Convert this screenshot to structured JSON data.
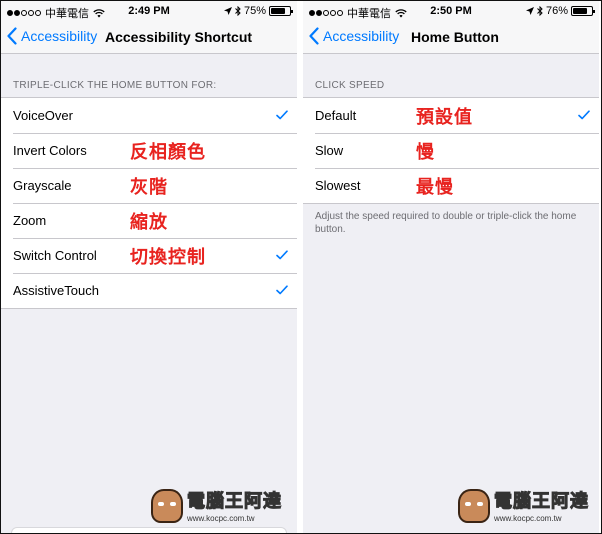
{
  "left": {
    "status": {
      "carrier": "中華電信",
      "time": "2:49 PM",
      "battery": "75%",
      "battery_level": 0.75
    },
    "nav": {
      "back_label": "Accessibility",
      "title": "Accessibility Shortcut"
    },
    "section_header": "TRIPLE-CLICK THE HOME BUTTON FOR:",
    "rows": [
      {
        "label": "VoiceOver",
        "zh": "",
        "checked": true
      },
      {
        "label": "Invert Colors",
        "zh": "反相顏色",
        "checked": false
      },
      {
        "label": "Grayscale",
        "zh": "灰階",
        "checked": false
      },
      {
        "label": "Zoom",
        "zh": "縮放",
        "checked": false
      },
      {
        "label": "Switch Control",
        "zh": "切換控制",
        "checked": true
      },
      {
        "label": "AssistiveTouch",
        "zh": "",
        "checked": true
      }
    ]
  },
  "right": {
    "status": {
      "carrier": "中華電信",
      "time": "2:50 PM",
      "battery": "76%",
      "battery_level": 0.76
    },
    "nav": {
      "back_label": "Accessibility",
      "title": "Home Button"
    },
    "section_header": "CLICK SPEED",
    "rows": [
      {
        "label": "Default",
        "zh": "預設值",
        "checked": true
      },
      {
        "label": "Slow",
        "zh": "慢",
        "checked": false
      },
      {
        "label": "Slowest",
        "zh": "最慢",
        "checked": false
      }
    ],
    "footer": "Adjust the speed required to double or triple-click the home button."
  },
  "watermark": {
    "title": "電腦王阿達",
    "url": "www.kocpc.com.tw"
  },
  "colors": {
    "accent": "#007aff",
    "annotation": "#e8231f",
    "background": "#efeff4"
  },
  "icons": [
    "signal-dots-icon",
    "wifi-icon",
    "location-arrow-icon",
    "bluetooth-icon",
    "battery-icon",
    "chevron-left-icon",
    "checkmark-icon"
  ]
}
